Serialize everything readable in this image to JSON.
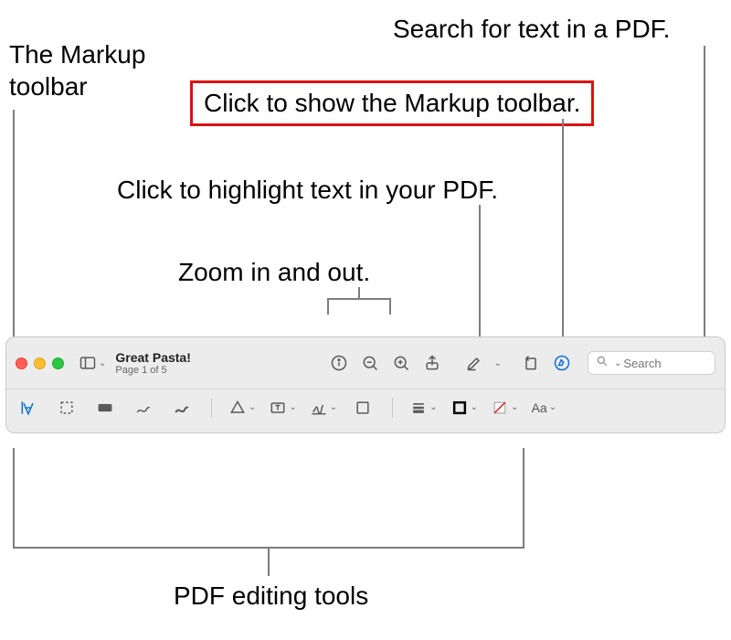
{
  "labels": {
    "markup_toolbar": "The Markup toolbar",
    "search": "Search for text in a PDF.",
    "show_markup": "Click to show the Markup toolbar.",
    "highlight": "Click to highlight text in your PDF.",
    "zoom": "Zoom in and out.",
    "editing_tools": "PDF editing tools"
  },
  "doc": {
    "title": "Great Pasta!",
    "subtitle": "Page 1 of 5"
  },
  "search_placeholder": "Search",
  "icons": {
    "sidebar": "sidebar-icon",
    "info": "info-icon",
    "zoom_out": "zoom-out-icon",
    "zoom_in": "zoom-in-icon",
    "share": "share-icon",
    "highlight": "highlight-icon",
    "rotate": "rotate-icon",
    "markup": "markup-pen-icon",
    "text_select": "text-select-icon",
    "rect_select": "rectangle-select-icon",
    "redact": "redact-icon",
    "sketch": "sketch-icon",
    "draw": "draw-icon",
    "shapes": "shapes-icon",
    "textbox": "textbox-icon",
    "sign": "sign-icon",
    "note": "note-icon",
    "align": "align-icon",
    "border_color": "border-color-icon",
    "fill_color": "fill-color-icon",
    "font": "font-style-icon"
  }
}
